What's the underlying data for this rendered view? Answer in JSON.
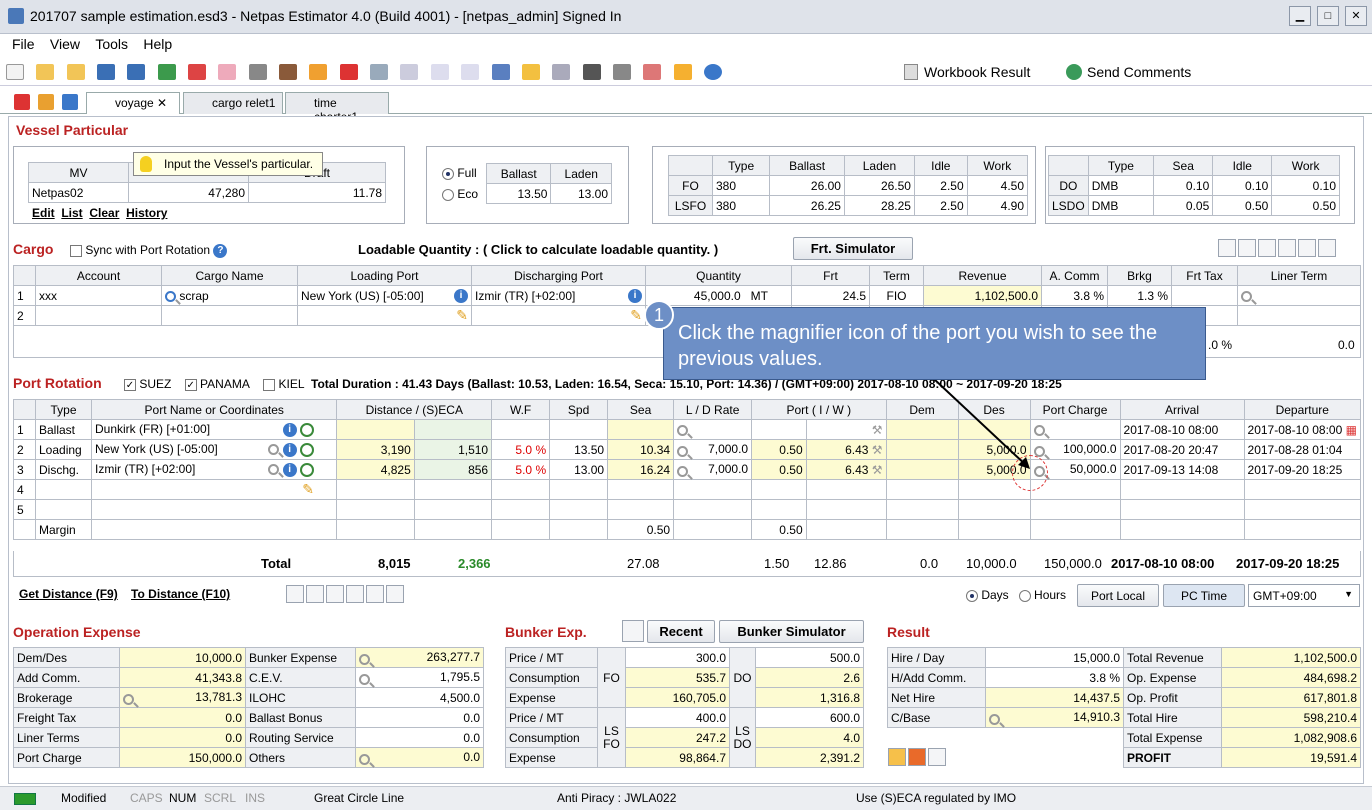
{
  "window": {
    "title": "201707 sample estimation.esd3 - Netpas Estimator 4.0 (Build 4001) - [netpas_admin] Signed In",
    "min": "▁",
    "max": "□",
    "close": "✕"
  },
  "menu": [
    "File",
    "View",
    "Tools",
    "Help"
  ],
  "toolbar": {
    "workbook": "Workbook Result",
    "send": "Send Comments"
  },
  "tabs": [
    {
      "label": "voyage"
    },
    {
      "label": "cargo relet1"
    },
    {
      "label": "time charter1"
    }
  ],
  "vessel": {
    "title": "Vessel Particular",
    "tooltip": "Input the Vessel's particular.",
    "headers": [
      "MV",
      "",
      "Draft"
    ],
    "name": "Netpas02",
    "dwt": "47,280",
    "draft": "11.78",
    "links": [
      "Edit",
      "List",
      "Clear",
      "History"
    ],
    "speed": {
      "headers": [
        "Ballast",
        "Laden"
      ],
      "full": "Full",
      "eco": "Eco",
      "ballast": "13.50",
      "laden": "13.00"
    },
    "fo": {
      "headers": [
        "Type",
        "Ballast",
        "Laden",
        "Idle",
        "Work"
      ],
      "rows": [
        [
          "FO",
          "380",
          "26.00",
          "26.50",
          "2.50",
          "4.50"
        ],
        [
          "LSFO",
          "380",
          "26.25",
          "28.25",
          "2.50",
          "4.90"
        ]
      ]
    },
    "do": {
      "headers": [
        "Type",
        "Sea",
        "Idle",
        "Work"
      ],
      "rows": [
        [
          "DO",
          "DMB",
          "0.10",
          "0.10",
          "0.10"
        ],
        [
          "LSDO",
          "DMB",
          "0.05",
          "0.50",
          "0.50"
        ]
      ]
    }
  },
  "cargo": {
    "title": "Cargo",
    "sync": "Sync with Port Rotation",
    "loadable": "Loadable Quantity : ( Click to calculate loadable quantity. )",
    "frt": "Frt. Simulator",
    "headers": [
      "Account",
      "Cargo Name",
      "Loading Port",
      "Discharging Port",
      "Quantity",
      "Frt",
      "Term",
      "Revenue",
      "A. Comm",
      "Brkg",
      "Frt Tax",
      "Liner Term"
    ],
    "row1": {
      "n": "1",
      "account": "xxx",
      "cargo": "scrap",
      "load": "New York (US) [-05:00]",
      "disch": "Izmir (TR) [+02:00]",
      "qty": "45,000.0",
      "unit": "MT",
      "frt": "24.5",
      "term": "FIO",
      "revenue": "1,102,500.0",
      "acomm": "3.8 %",
      "brkg": "1.3 %"
    },
    "row2": "2",
    "total_pct": ".0 %",
    "total_val": "0.0"
  },
  "callout": {
    "num": "1",
    "text": "Click the magnifier icon of the port you wish to see the previous values."
  },
  "port": {
    "title": "Port Rotation",
    "suez": "SUEZ",
    "panama": "PANAMA",
    "kiel": "KIEL",
    "duration": "Total Duration : 41.43 Days (Ballast: 10.53, Laden: 16.54, Seca: 15.10, Port: 14.36) / (GMT+09:00) 2017-08-10 08:00 ~ 2017-09-20 18:25",
    "headers": [
      "Type",
      "Port Name or Coordinates",
      "Distance / (S)ECA",
      "W.F",
      "Spd",
      "Sea",
      "L / D Rate",
      "Port ( I / W )",
      "Dem",
      "Des",
      "Port Charge",
      "Arrival",
      "Departure"
    ],
    "rows": [
      {
        "n": "1",
        "type": "Ballast",
        "name": "Dunkirk (FR) [+01:00]",
        "dist": "",
        "eca": "",
        "wf": "",
        "spd": "",
        "sea": "",
        "rate": "",
        "pi": "",
        "pw": "",
        "dem": "",
        "des": "",
        "charge": "",
        "arr": "2017-08-10 08:00",
        "dep": "2017-08-10 08:00"
      },
      {
        "n": "2",
        "type": "Loading",
        "name": "New York (US) [-05:00]",
        "dist": "3,190",
        "eca": "1,510",
        "wf": "5.0 %",
        "spd": "13.50",
        "sea": "10.34",
        "rate": "7,000.0",
        "pi": "0.50",
        "pw": "6.43",
        "dem": "",
        "des": "5,000.0",
        "charge": "100,000.0",
        "arr": "2017-08-20 20:47",
        "dep": "2017-08-28 01:04"
      },
      {
        "n": "3",
        "type": "Dischg.",
        "name": "Izmir (TR) [+02:00]",
        "dist": "4,825",
        "eca": "856",
        "wf": "5.0 %",
        "spd": "13.00",
        "sea": "16.24",
        "rate": "7,000.0",
        "pi": "0.50",
        "pw": "6.43",
        "dem": "",
        "des": "5,000.0",
        "charge": "50,000.0",
        "arr": "2017-09-13 14:08",
        "dep": "2017-09-20 18:25"
      }
    ],
    "margin": "Margin",
    "margin_sea": "0.50",
    "margin_port": "0.50",
    "total": {
      "label": "Total",
      "dist": "8,015",
      "eca": "2,366",
      "sea": "27.08",
      "pi": "1.50",
      "pw": "12.86",
      "dem": "0.0",
      "des": "10,000.0",
      "charge": "150,000.0",
      "arr": "2017-08-10 08:00",
      "dep": "2017-09-20 18:25"
    }
  },
  "links": {
    "get": "Get Distance (F9)",
    "to": "To Distance (F10)",
    "days": "Days",
    "hours": "Hours",
    "local": "Port Local",
    "pc": "PC Time",
    "gmt": "GMT+09:00"
  },
  "opex": {
    "title": "Operation Expense",
    "rows": [
      [
        "Dem/Des",
        "10,000.0",
        "Bunker Expense",
        "263,277.7"
      ],
      [
        "Add Comm.",
        "41,343.8",
        "C.E.V.",
        "1,795.5"
      ],
      [
        "Brokerage",
        "13,781.3",
        "ILOHC",
        "4,500.0"
      ],
      [
        "Freight Tax",
        "0.0",
        "Ballast Bonus",
        "0.0"
      ],
      [
        "Liner Terms",
        "0.0",
        "Routing Service",
        "0.0"
      ],
      [
        "Port Charge",
        "150,000.0",
        "Others",
        "0.0"
      ]
    ]
  },
  "bunker": {
    "title": "Bunker Exp.",
    "recent": "Recent",
    "sim": "Bunker Simulator",
    "fo": "FO",
    "do": "DO",
    "lsfo": "LS FO",
    "lsdo": "LS DO",
    "rows": [
      [
        "Price / MT",
        "300.0",
        "500.0"
      ],
      [
        "Consumption",
        "535.7",
        "2.6"
      ],
      [
        "Expense",
        "160,705.0",
        "1,316.8"
      ],
      [
        "Price / MT",
        "400.0",
        "600.0"
      ],
      [
        "Consumption",
        "247.2",
        "4.0"
      ],
      [
        "Expense",
        "98,864.7",
        "2,391.2"
      ]
    ]
  },
  "result": {
    "title": "Result",
    "rows": [
      [
        "Hire / Day",
        "15,000.0",
        "Total Revenue",
        "1,102,500.0"
      ],
      [
        "H/Add Comm.",
        "3.8 %",
        "Op. Expense",
        "484,698.2"
      ],
      [
        "Net Hire",
        "14,437.5",
        "Op. Profit",
        "617,801.8"
      ],
      [
        "C/Base",
        "14,910.3",
        "Total Hire",
        "598,210.4"
      ],
      [
        "",
        "",
        "Total Expense",
        "1,082,908.6"
      ],
      [
        "",
        "",
        "PROFIT",
        "19,591.4"
      ]
    ]
  },
  "status": {
    "modified": "Modified",
    "caps": "CAPS",
    "num": "NUM",
    "scrl": "SCRL",
    "ins": "INS",
    "gc": "Great Circle Line",
    "anti": "Anti Piracy : JWLA022",
    "eca": "Use (S)ECA regulated by IMO"
  }
}
